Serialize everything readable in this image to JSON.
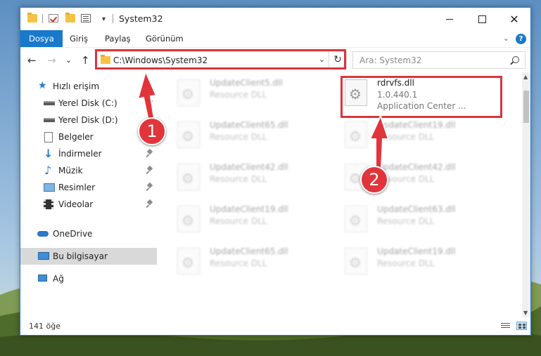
{
  "window": {
    "title": "System32",
    "qat_dropdown": "▾",
    "min_glyph": "",
    "max_glyph": "",
    "close_glyph": "✕"
  },
  "ribbon": {
    "tabs": [
      "Dosya",
      "Giriş",
      "Paylaş",
      "Görünüm"
    ],
    "expand_glyph": "⌄",
    "help_glyph": "?"
  },
  "nav": {
    "back_glyph": "←",
    "forward_glyph": "→",
    "recent_glyph": "⌄",
    "up_glyph": "↑",
    "address": "C:\\Windows\\System32",
    "address_drop_glyph": "⌄",
    "refresh_glyph": "↻",
    "search_placeholder": "Ara: System32"
  },
  "sidebar": {
    "items": [
      {
        "label": "Hızlı erişim",
        "icon": "star-icon"
      },
      {
        "label": "Yerel Disk (C:)",
        "icon": "drive-icon"
      },
      {
        "label": "Yerel Disk (D:)",
        "icon": "drive-icon"
      },
      {
        "label": "Belgeler",
        "icon": "documents-icon"
      },
      {
        "label": "İndirmeler",
        "icon": "download-icon"
      },
      {
        "label": "Müzik",
        "icon": "music-icon"
      },
      {
        "label": "Resimler",
        "icon": "pictures-icon"
      },
      {
        "label": "Videolar",
        "icon": "video-icon"
      },
      {
        "label": "OneDrive",
        "icon": "cloud-icon"
      },
      {
        "label": "Bu bilgisayar",
        "icon": "computer-icon"
      },
      {
        "label": "Ağ",
        "icon": "network-icon"
      }
    ]
  },
  "files": {
    "left": [
      {
        "name": "UpdateClient5.dll",
        "sub": "Resource DLL"
      },
      {
        "name": "UpdateClient65.dll",
        "sub": "Resource DLL"
      },
      {
        "name": "UpdateClient42.dll",
        "sub": "Resource DLL"
      },
      {
        "name": "UpdateClient19.dll",
        "sub": "Resource DLL"
      },
      {
        "name": "UpdateClient65.dll",
        "sub": "Resource DLL"
      }
    ],
    "right": [
      {
        "name": "rdrvfs.dll",
        "version": "1.0.440.1",
        "company": "Application Center ..."
      },
      {
        "name": "UpdateClient19.dll",
        "sub": "Resource DLL"
      },
      {
        "name": "UpdateClient42.dll",
        "sub": "Resource DLL"
      },
      {
        "name": "UpdateClient63.dll",
        "sub": "Resource DLL"
      },
      {
        "name": "UpdateClient19.dll",
        "sub": "Resource DLL"
      }
    ]
  },
  "scrollbar": {
    "up_glyph": "▲",
    "down_glyph": "▼"
  },
  "status": {
    "item_count": "141 öğe"
  },
  "markers": {
    "one": "1",
    "two": "2"
  },
  "colors": {
    "accent": "#1979ca",
    "highlight": "#d9363e",
    "marker": "#e2343b"
  }
}
